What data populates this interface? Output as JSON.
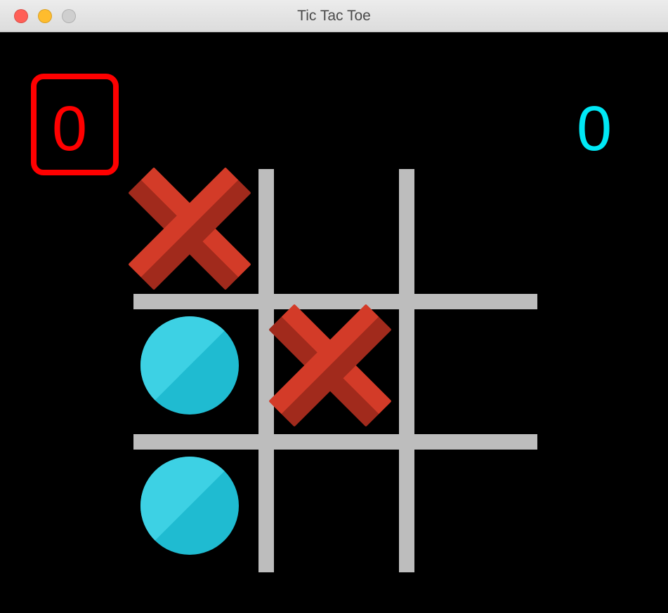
{
  "window": {
    "title": "Tic Tac Toe"
  },
  "scores": {
    "x": "0",
    "o": "0",
    "active": "x"
  },
  "colors": {
    "x": "#ff0000",
    "o": "#00e8f5",
    "grid": "#bdbdbd",
    "piece_x": "#c0392b",
    "piece_o": "#1fbbd1"
  },
  "board": {
    "cells": [
      [
        "X",
        "",
        ""
      ],
      [
        "O",
        "X",
        ""
      ],
      [
        "O",
        "",
        ""
      ]
    ]
  }
}
